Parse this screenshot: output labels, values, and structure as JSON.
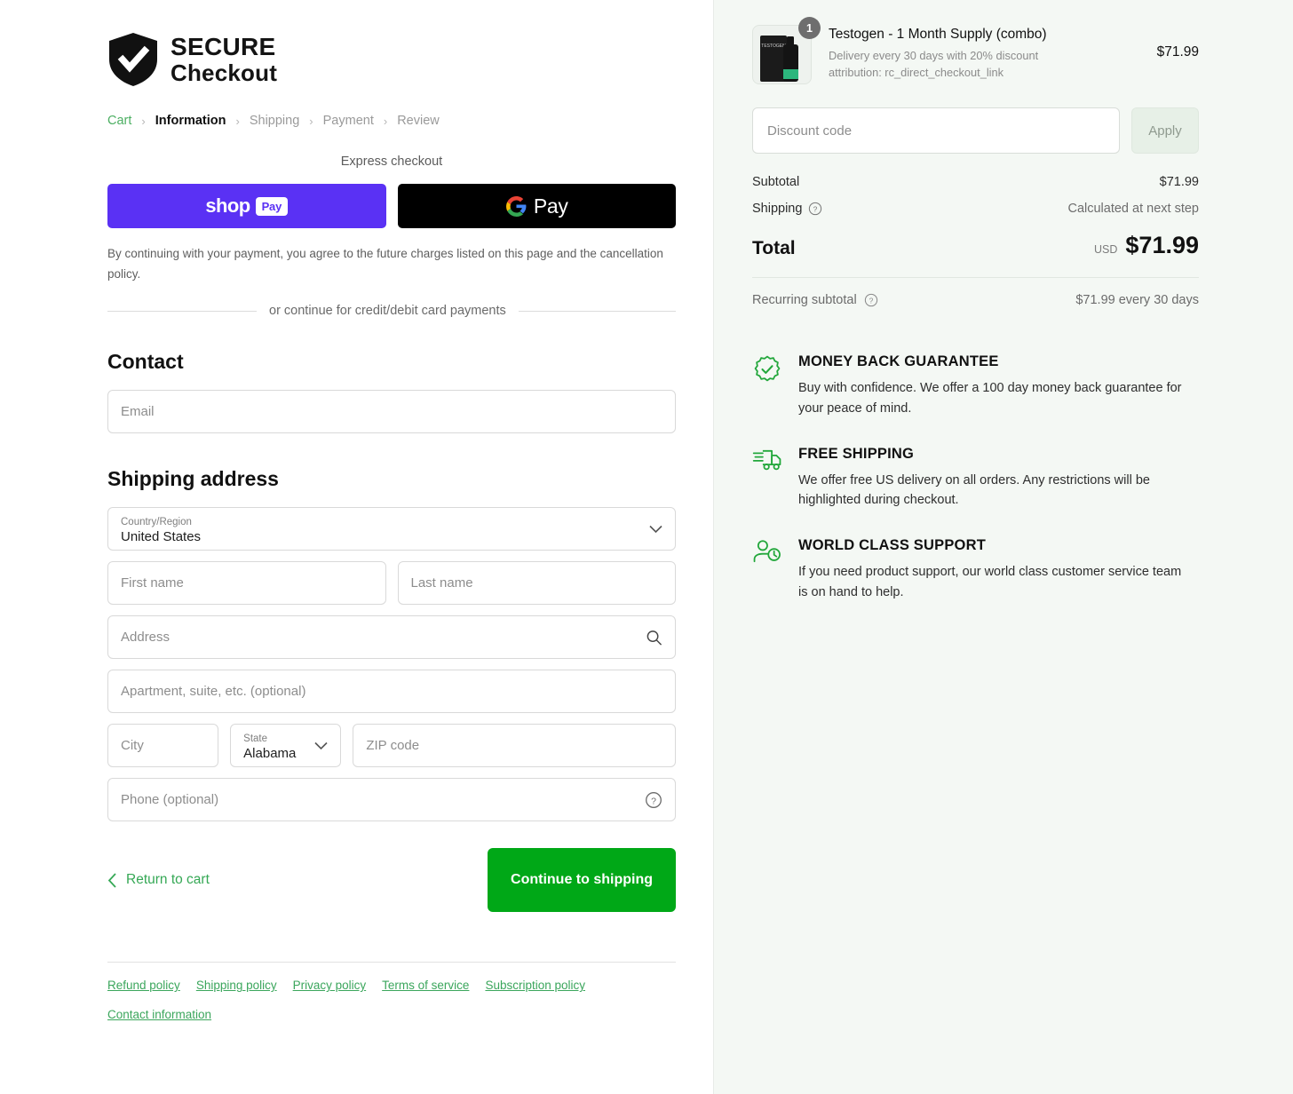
{
  "brand": {
    "line1": "SECURE",
    "line2": "Checkout",
    "icon": "shield-check-icon"
  },
  "breadcrumbs": [
    {
      "label": "Cart",
      "state": "link"
    },
    {
      "label": "Information",
      "state": "current"
    },
    {
      "label": "Shipping",
      "state": "muted"
    },
    {
      "label": "Payment",
      "state": "muted"
    },
    {
      "label": "Review",
      "state": "muted"
    }
  ],
  "breadcrumb_separator": "›",
  "express": {
    "heading": "Express checkout",
    "shop_pay": {
      "word": "shop",
      "chip": "Pay"
    },
    "google_pay": {
      "word": "Pay",
      "icon": "google-g-icon"
    },
    "legal": "By continuing with your payment, you agree to the future charges listed on this page and the cancellation policy.",
    "divider_text": "or continue for credit/debit card payments"
  },
  "contact": {
    "title": "Contact",
    "email_placeholder": "Email"
  },
  "shipping_address": {
    "title": "Shipping address",
    "country": {
      "label": "Country/Region",
      "value": "United States"
    },
    "first_name_placeholder": "First name",
    "last_name_placeholder": "Last name",
    "address_placeholder": "Address",
    "apartment_placeholder": "Apartment, suite, etc. (optional)",
    "city_placeholder": "City",
    "state": {
      "label": "State",
      "value": "Alabama"
    },
    "zip_placeholder": "ZIP code",
    "phone_placeholder": "Phone (optional)"
  },
  "actions": {
    "return_label": "Return to cart",
    "continue_label": "Continue to shipping",
    "accent_green": "#00a817"
  },
  "footer_links": [
    "Refund policy",
    "Shipping policy",
    "Privacy policy",
    "Terms of service",
    "Subscription policy",
    "Contact information"
  ],
  "summary": {
    "product": {
      "name": "Testogen - 1 Month Supply (combo)",
      "sub1": "Delivery every 30 days with 20% discount",
      "sub2": "attribution: rc_direct_checkout_link",
      "price": "$71.99",
      "quantity": "1",
      "thumb_caption": "TESTOGEN"
    },
    "discount_placeholder": "Discount code",
    "apply_label": "Apply",
    "subtotal_label": "Subtotal",
    "subtotal_value": "$71.99",
    "shipping_label": "Shipping",
    "shipping_value": "Calculated at next step",
    "total_label": "Total",
    "currency": "USD",
    "total_value": "$71.99",
    "recurring_label": "Recurring subtotal",
    "recurring_value": "$71.99 every 30 days"
  },
  "badges": [
    {
      "icon": "check-rosette-icon",
      "title": "MONEY BACK GUARANTEE",
      "text": "Buy with confidence. We offer a 100 day money back guarantee for your peace of mind."
    },
    {
      "icon": "delivery-truck-icon",
      "title": "FREE SHIPPING",
      "text": "We offer free US delivery on all orders. Any restrictions will be highlighted during checkout."
    },
    {
      "icon": "support-person-clock-icon",
      "title": "WORLD CLASS SUPPORT",
      "text": "If you need product support, our world class customer service team is on hand to help."
    }
  ]
}
